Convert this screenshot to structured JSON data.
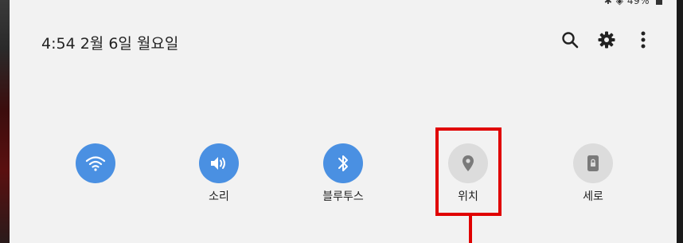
{
  "status_bar": {
    "text": "✱ ◈ 49%"
  },
  "header": {
    "datetime": "4:54  2월 6일 월요일"
  },
  "actions": {
    "search": "search-icon",
    "settings": "gear-icon",
    "more": "more-vert-icon"
  },
  "tiles": [
    {
      "id": "wifi",
      "label": "",
      "active": true,
      "icon": "wifi-icon"
    },
    {
      "id": "sound",
      "label": "소리",
      "active": true,
      "icon": "speaker-icon"
    },
    {
      "id": "bluetooth",
      "label": "블루투스",
      "active": true,
      "icon": "bluetooth-icon"
    },
    {
      "id": "location",
      "label": "위치",
      "active": false,
      "icon": "location-pin-icon"
    },
    {
      "id": "rotation",
      "label": "세로",
      "active": false,
      "icon": "portrait-lock-icon"
    }
  ],
  "colors": {
    "active": "#4a90e2",
    "inactive": "#dcdcdc",
    "highlight": "#e00000"
  }
}
